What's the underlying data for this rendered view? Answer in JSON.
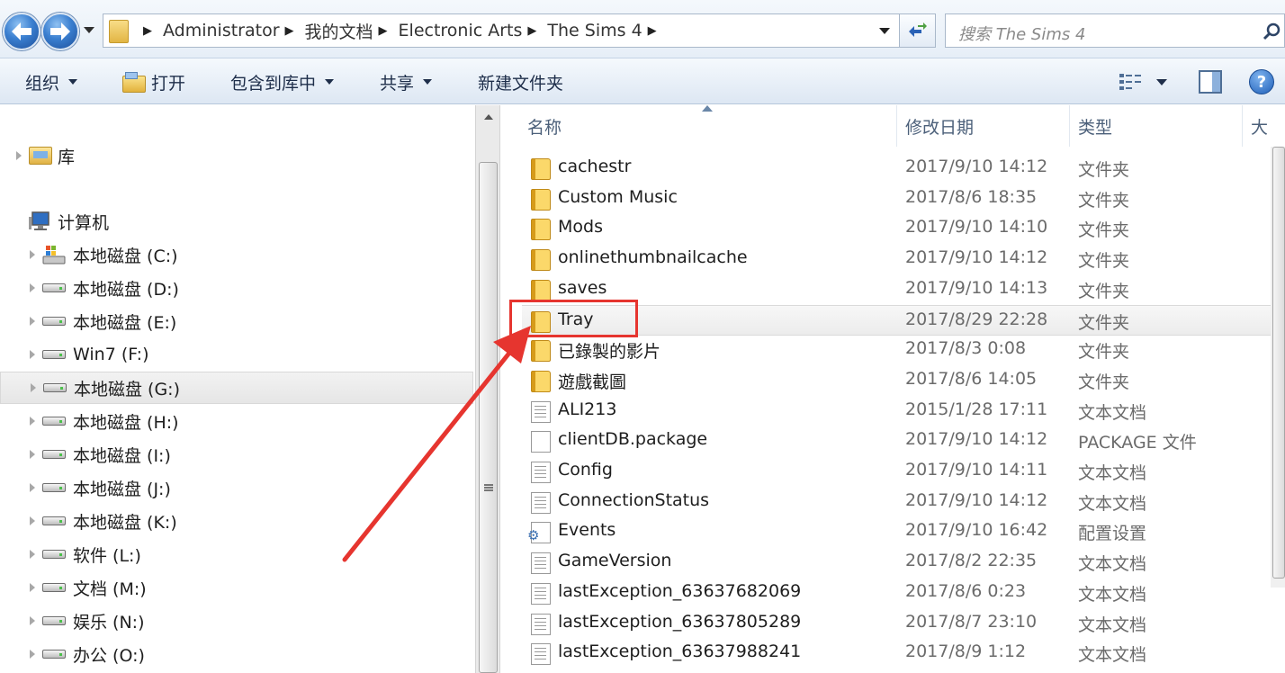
{
  "address_bar": {
    "crumbs": [
      "Administrator",
      "我的文档",
      "Electronic Arts",
      "The Sims 4"
    ],
    "search_placeholder": "搜索 The Sims 4"
  },
  "toolbar": {
    "organize": "组织",
    "open": "打开",
    "include_in_library": "包含到库中",
    "share": "共享",
    "new_folder": "新建文件夹"
  },
  "nav": {
    "library": "库",
    "computer": "计算机",
    "drives": [
      {
        "label": "本地磁盘 (C:)",
        "system": true
      },
      {
        "label": "本地磁盘 (D:)"
      },
      {
        "label": "本地磁盘 (E:)"
      },
      {
        "label": "Win7 (F:)"
      },
      {
        "label": "本地磁盘 (G:)",
        "selected": true
      },
      {
        "label": "本地磁盘 (H:)"
      },
      {
        "label": "本地磁盘 (I:)"
      },
      {
        "label": "本地磁盘 (J:)"
      },
      {
        "label": "本地磁盘 (K:)"
      },
      {
        "label": "软件 (L:)"
      },
      {
        "label": "文档 (M:)"
      },
      {
        "label": "娱乐 (N:)"
      },
      {
        "label": "办公 (O:)"
      }
    ]
  },
  "columns": {
    "name": "名称",
    "date": "修改日期",
    "type": "类型",
    "size": "大"
  },
  "files": [
    {
      "name": "cachestr",
      "date": "2017/9/10 14:12",
      "type": "文件夹",
      "icon": "folder-icon"
    },
    {
      "name": "Custom Music",
      "date": "2017/8/6 18:35",
      "type": "文件夹",
      "icon": "folder-icon"
    },
    {
      "name": "Mods",
      "date": "2017/9/10 14:10",
      "type": "文件夹",
      "icon": "folder-icon"
    },
    {
      "name": "onlinethumbnailcache",
      "date": "2017/9/10 14:12",
      "type": "文件夹",
      "icon": "folder-icon"
    },
    {
      "name": "saves",
      "date": "2017/9/10 14:13",
      "type": "文件夹",
      "icon": "folder-icon"
    },
    {
      "name": "Tray",
      "date": "2017/8/29 22:28",
      "type": "文件夹",
      "icon": "folder-icon",
      "highlight": true
    },
    {
      "name": "已錄製的影片",
      "date": "2017/8/3 0:08",
      "type": "文件夹",
      "icon": "folder-icon"
    },
    {
      "name": "遊戲截圖",
      "date": "2017/8/6 14:05",
      "type": "文件夹",
      "icon": "folder-icon"
    },
    {
      "name": "ALI213",
      "date": "2015/1/28 17:11",
      "type": "文本文档",
      "icon": "text-file-icon"
    },
    {
      "name": "clientDB.package",
      "date": "2017/9/10 14:12",
      "type": "PACKAGE 文件",
      "icon": "blank-file-icon"
    },
    {
      "name": "Config",
      "date": "2017/9/10 14:11",
      "type": "文本文档",
      "icon": "text-file-icon"
    },
    {
      "name": "ConnectionStatus",
      "date": "2017/9/10 14:12",
      "type": "文本文档",
      "icon": "text-file-icon"
    },
    {
      "name": "Events",
      "date": "2017/9/10 16:42",
      "type": "配置设置",
      "icon": "config-file-icon"
    },
    {
      "name": "GameVersion",
      "date": "2017/8/2 22:35",
      "type": "文本文档",
      "icon": "text-file-icon"
    },
    {
      "name": "lastException_63637682069",
      "date": "2017/8/6 0:23",
      "type": "文本文档",
      "icon": "text-file-icon"
    },
    {
      "name": "lastException_63637805289",
      "date": "2017/8/7 23:10",
      "type": "文本文档",
      "icon": "text-file-icon"
    },
    {
      "name": "lastException_63637988241",
      "date": "2017/8/9 1:12",
      "type": "文本文档",
      "icon": "text-file-icon"
    }
  ],
  "colors": {
    "annotation": "#e6352f"
  }
}
